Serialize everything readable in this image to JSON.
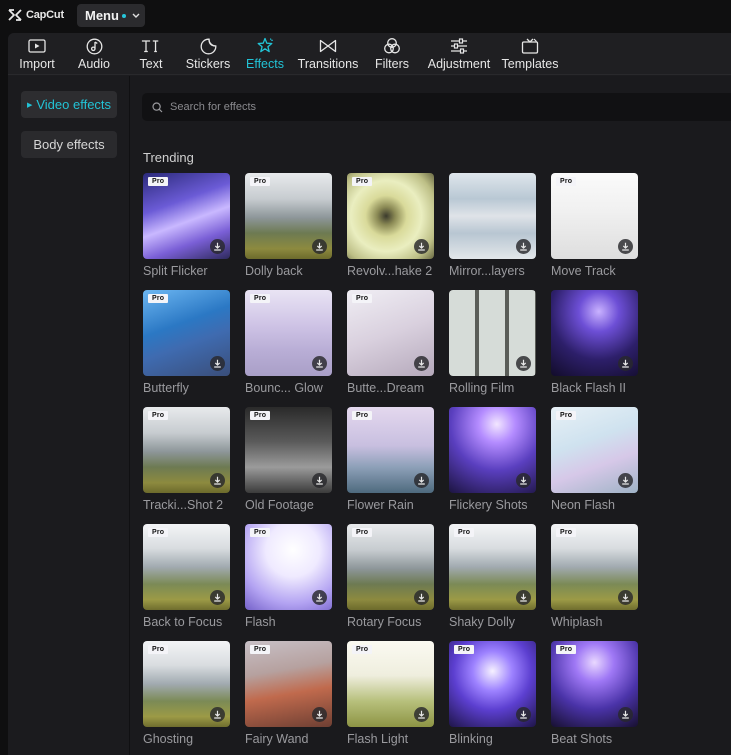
{
  "app": {
    "logo_text": "CapCut",
    "menu_label": "Menu",
    "accent_color": "#22c3d6"
  },
  "toolbar": {
    "items": [
      {
        "label": "Import",
        "icon": "import-icon",
        "active": false
      },
      {
        "label": "Audio",
        "icon": "audio-icon",
        "active": false
      },
      {
        "label": "Text",
        "icon": "text-icon",
        "active": false
      },
      {
        "label": "Stickers",
        "icon": "stickers-icon",
        "active": false
      },
      {
        "label": "Effects",
        "icon": "effects-icon",
        "active": true
      },
      {
        "label": "Transitions",
        "icon": "transitions-icon",
        "active": false
      },
      {
        "label": "Filters",
        "icon": "filters-icon",
        "active": false
      },
      {
        "label": "Adjustment",
        "icon": "adjustment-icon",
        "active": false
      },
      {
        "label": "Templates",
        "icon": "templates-icon",
        "active": false
      }
    ]
  },
  "sidebar": {
    "items": [
      {
        "label": "Video effects",
        "active": true
      },
      {
        "label": "Body effects",
        "active": false
      }
    ]
  },
  "search": {
    "placeholder": "Search for effects"
  },
  "section": {
    "title": "Trending"
  },
  "pro_badge": "Pro",
  "effects": [
    {
      "name": "Split Flicker",
      "pro": true
    },
    {
      "name": "Dolly back",
      "pro": true
    },
    {
      "name": "Revolv...hake 2",
      "pro": true
    },
    {
      "name": "Mirror...layers",
      "pro": false
    },
    {
      "name": "Move Track",
      "pro": true
    },
    {
      "name": "Butterfly",
      "pro": true
    },
    {
      "name": "Bounc... Glow",
      "pro": true
    },
    {
      "name": "Butte...Dream",
      "pro": true
    },
    {
      "name": "Rolling Film",
      "pro": false
    },
    {
      "name": "Black Flash II",
      "pro": false
    },
    {
      "name": "Tracki...Shot 2",
      "pro": true
    },
    {
      "name": "Old Footage",
      "pro": true
    },
    {
      "name": "Flower Rain",
      "pro": true
    },
    {
      "name": "Flickery Shots",
      "pro": false
    },
    {
      "name": "Neon Flash",
      "pro": true
    },
    {
      "name": "Back to Focus",
      "pro": true
    },
    {
      "name": "Flash",
      "pro": true
    },
    {
      "name": "Rotary Focus",
      "pro": true
    },
    {
      "name": "Shaky Dolly",
      "pro": true
    },
    {
      "name": "Whiplash",
      "pro": true
    },
    {
      "name": "Ghosting",
      "pro": true
    },
    {
      "name": "Fairy Wand",
      "pro": true
    },
    {
      "name": "Flash Light",
      "pro": true
    },
    {
      "name": "Blinking",
      "pro": true
    },
    {
      "name": "Beat Shots",
      "pro": true
    }
  ]
}
